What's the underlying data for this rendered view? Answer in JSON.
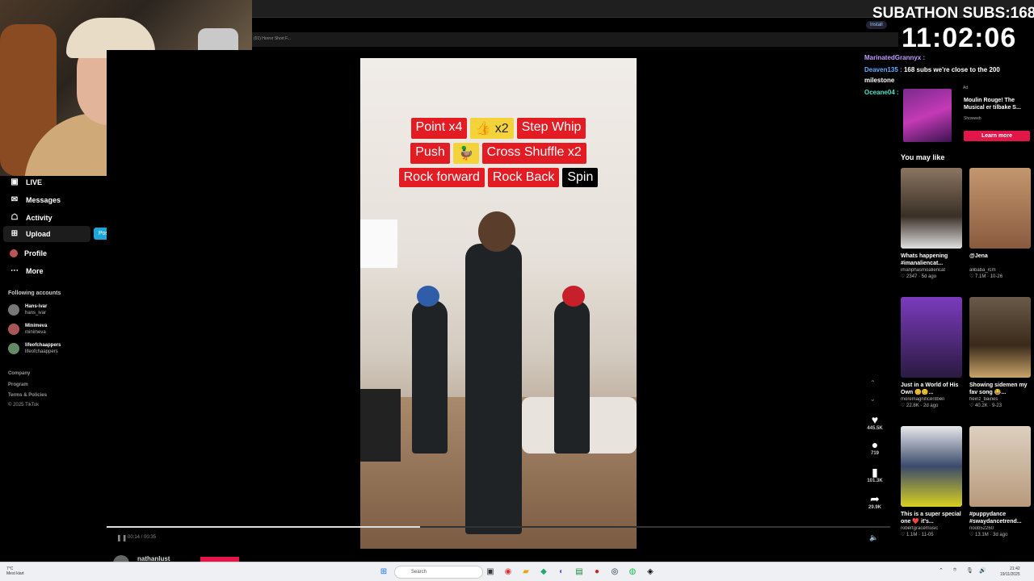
{
  "browser": {
    "tab_text": "(01) Horror Short F...",
    "install_label": "Install"
  },
  "overlay": {
    "subathon_text": "SUBATHON SUBS:168",
    "timer": "11:02:06"
  },
  "chat": [
    {
      "user": "MarinatedGrannyx :",
      "text": "",
      "color": "#c39bff"
    },
    {
      "user": "Deaven135 :",
      "text": "168 subs we're close to the 200",
      "color": "#5fb0ff"
    },
    {
      "user": "",
      "text": "milestone",
      "color": "#ffffff"
    },
    {
      "user": "Oceane04 :",
      "text": "",
      "color": "#4ee0c8"
    }
  ],
  "sidebar": {
    "items": [
      {
        "label": "LIVE",
        "icon": "live-icon"
      },
      {
        "label": "Messages",
        "icon": "messages-icon"
      },
      {
        "label": "Activity",
        "icon": "activity-icon"
      },
      {
        "label": "Upload",
        "icon": "upload-icon"
      },
      {
        "label": "Profile",
        "icon": "profile-icon"
      },
      {
        "label": "More",
        "icon": "more-icon"
      }
    ],
    "post_video_label": "Post video",
    "following_title": "Following accounts",
    "following": [
      {
        "name": "Hans-ivar",
        "handle": "hans_ivar"
      },
      {
        "name": "Minimeva",
        "handle": "minimeva"
      },
      {
        "name": "lifeofchaappers",
        "handle": "lifeofchaappers"
      }
    ],
    "footer": [
      "Company",
      "Program",
      "Terms & Policies",
      "© 2025 TikTok"
    ]
  },
  "video": {
    "tags": [
      [
        {
          "text": "Point x4",
          "style": "red"
        },
        {
          "text": "👍 x2",
          "style": "yellow"
        },
        {
          "text": "Step Whip",
          "style": "red"
        }
      ],
      [
        {
          "text": "Push",
          "style": "red"
        },
        {
          "text": "🦆",
          "style": "yellow"
        },
        {
          "text": "Cross Shuffle x2",
          "style": "red"
        }
      ],
      [
        {
          "text": "Rock forward",
          "style": "red"
        },
        {
          "text": "Rock Back",
          "style": "red"
        },
        {
          "text": "Spin",
          "style": "black"
        }
      ]
    ],
    "time": "00:14 / 00:35",
    "progress_fraction": 0.4,
    "author": "nathanlust",
    "actions": {
      "likes": "445.5K",
      "comments": "719",
      "saves": "101.3K",
      "shares": "29.9K"
    }
  },
  "ad": {
    "tag": "Ad",
    "title": "Moulin Rouge! The Musical er tilbake S...",
    "source": "Showweb",
    "cta": "Learn more"
  },
  "you_may_like": {
    "title": "You may like",
    "cards": [
      {
        "title": "Whats happening #imanaliencat...",
        "user": "imanphasmoaliencat",
        "stats": "♡ 2347 · 5d ago",
        "thumb": "#6b5a48"
      },
      {
        "title": "@Jena",
        "user": "alibaba_rcm",
        "stats": "♡ 7.1M · 10-26",
        "thumb": "#b88563"
      },
      {
        "title": "Just in a World of His Own 😊😊...",
        "user": "moremagnificentben",
        "stats": "♡ 22.8K · 2d ago",
        "thumb": "#5a2a8a"
      },
      {
        "title": "Showing sidemen my fav song 😂...",
        "user": "heinz_baines",
        "stats": "♡ 40.2K · 9-23",
        "thumb": "#4a3a2a"
      },
      {
        "title": "This is a super special one ❤️ it's...",
        "user": "robertgracemusic",
        "stats": "♡ 1.1M · 11-05",
        "thumb": "#3a4a6a"
      },
      {
        "title": "#puppydance #swaydancetrend...",
        "user": "noob52260",
        "stats": "♡ 13.1M · 3d ago",
        "thumb": "#c9b49c"
      }
    ]
  },
  "taskbar": {
    "weather_temp": "7°C",
    "weather_desc": "Mest klart",
    "search_placeholder": "Search",
    "clock_time": "21:42",
    "clock_date": "19/11/2025"
  }
}
